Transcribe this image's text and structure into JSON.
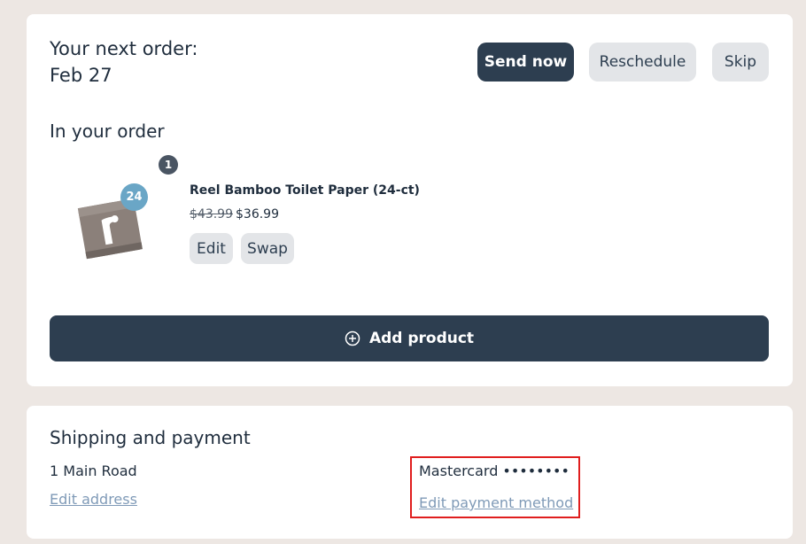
{
  "order": {
    "next_label": "Your next order:",
    "next_date": "Feb 27",
    "buttons": {
      "send_now": "Send now",
      "reschedule": "Reschedule",
      "skip": "Skip"
    },
    "in_order_title": "In your order",
    "items": [
      {
        "quantity": "1",
        "pack_count": "24",
        "name": "Reel Bamboo Toilet Paper (24-ct)",
        "price_original": "$43.99",
        "price_current": "$36.99",
        "edit_label": "Edit",
        "swap_label": "Swap"
      }
    ],
    "add_product_label": "Add product"
  },
  "shipping": {
    "title": "Shipping and payment",
    "address": "1 Main Road",
    "edit_address_label": "Edit address",
    "payment_method": "Mastercard ••••••••",
    "edit_payment_label": "Edit payment method"
  },
  "colors": {
    "page_bg": "#ede7e3",
    "primary_dark": "#2d3e50",
    "secondary_button": "#e3e5e8",
    "link": "#7f9ab7",
    "pack_badge": "#6aa6c6",
    "highlight_border": "#e01e1e"
  },
  "icons": {
    "add_product": "plus-circle-icon",
    "product_image": "toilet-paper-roll-image"
  }
}
